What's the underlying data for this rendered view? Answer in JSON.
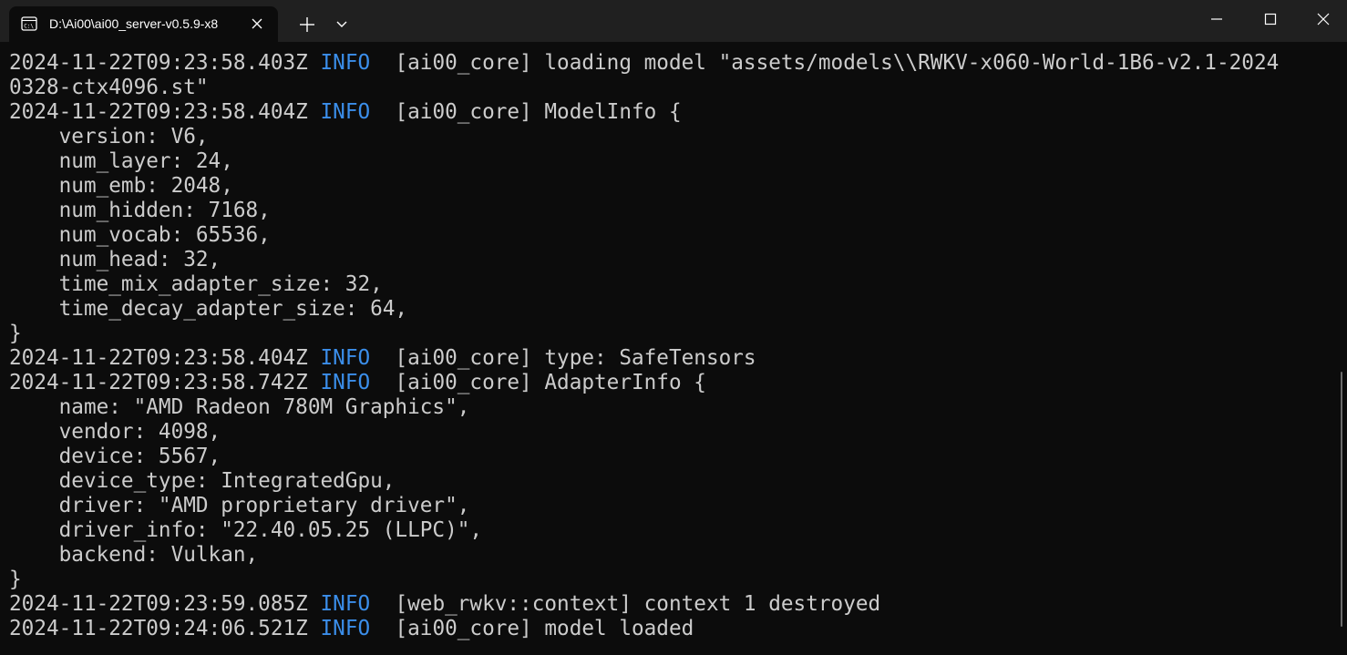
{
  "window": {
    "tab_title": "D:\\Ai00\\ai00_server-v0.5.9-x8",
    "icons": {
      "tab": "terminal-icon",
      "tab_close": "close-icon",
      "new_tab": "plus-icon",
      "dropdown": "chevron-down-icon",
      "minimize": "minimize-icon",
      "maximize": "maximize-icon",
      "close": "close-icon"
    }
  },
  "colors": {
    "background": "#0c0c0c",
    "titlebar": "#202020",
    "text": "#cccccc",
    "info": "#3b8eea"
  },
  "console": {
    "lines": [
      {
        "ts": "2024-11-22T09:23:58.403Z",
        "level": "INFO",
        "msg": "[ai00_core] loading model \"assets/models\\\\RWKV-x060-World-1B6-v2.1-2024"
      },
      {
        "text": "0328-ctx4096.st\""
      },
      {
        "ts": "2024-11-22T09:23:58.404Z",
        "level": "INFO",
        "msg": "[ai00_core] ModelInfo {"
      },
      {
        "text": "    version: V6,"
      },
      {
        "text": "    num_layer: 24,"
      },
      {
        "text": "    num_emb: 2048,"
      },
      {
        "text": "    num_hidden: 7168,"
      },
      {
        "text": "    num_vocab: 65536,"
      },
      {
        "text": "    num_head: 32,"
      },
      {
        "text": "    time_mix_adapter_size: 32,"
      },
      {
        "text": "    time_decay_adapter_size: 64,"
      },
      {
        "text": "}"
      },
      {
        "ts": "2024-11-22T09:23:58.404Z",
        "level": "INFO",
        "msg": "[ai00_core] type: SafeTensors"
      },
      {
        "ts": "2024-11-22T09:23:58.742Z",
        "level": "INFO",
        "msg": "[ai00_core] AdapterInfo {"
      },
      {
        "text": "    name: \"AMD Radeon 780M Graphics\","
      },
      {
        "text": "    vendor: 4098,"
      },
      {
        "text": "    device: 5567,"
      },
      {
        "text": "    device_type: IntegratedGpu,"
      },
      {
        "text": "    driver: \"AMD proprietary driver\","
      },
      {
        "text": "    driver_info: \"22.40.05.25 (LLPC)\","
      },
      {
        "text": "    backend: Vulkan,"
      },
      {
        "text": "}"
      },
      {
        "ts": "2024-11-22T09:23:59.085Z",
        "level": "INFO",
        "msg": "[web_rwkv::context] context 1 destroyed"
      },
      {
        "ts": "2024-11-22T09:24:06.521Z",
        "level": "INFO",
        "msg": "[ai00_core] model loaded"
      }
    ]
  }
}
